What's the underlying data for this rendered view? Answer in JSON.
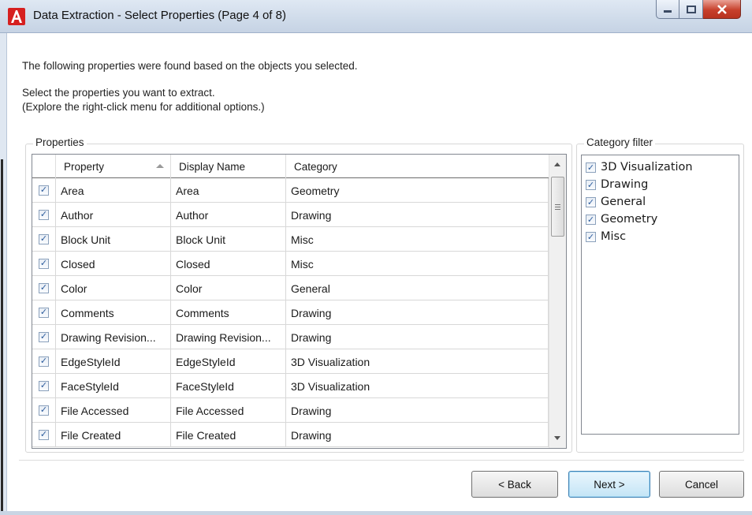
{
  "window": {
    "title": "Data Extraction - Select Properties (Page 4 of 8)",
    "app_icon": "autocad-logo-icon",
    "controls": [
      "minimize-icon",
      "maximize-icon",
      "close-icon"
    ]
  },
  "intro": {
    "line1": "The following properties were found based on the objects you selected.",
    "line2": "Select the properties you want to extract.",
    "line3": "(Explore the right-click menu for additional options.)"
  },
  "properties": {
    "group_label": "Properties",
    "columns": [
      "",
      "Property",
      "Display Name",
      "Category"
    ],
    "sort_column": "Property",
    "sort_direction": "ascending",
    "rows": [
      {
        "checked": true,
        "property": "Area",
        "display_name": "Area",
        "category": "Geometry"
      },
      {
        "checked": true,
        "property": "Author",
        "display_name": "Author",
        "category": "Drawing"
      },
      {
        "checked": true,
        "property": "Block Unit",
        "display_name": "Block Unit",
        "category": "Misc"
      },
      {
        "checked": true,
        "property": "Closed",
        "display_name": "Closed",
        "category": "Misc"
      },
      {
        "checked": true,
        "property": "Color",
        "display_name": "Color",
        "category": "General"
      },
      {
        "checked": true,
        "property": "Comments",
        "display_name": "Comments",
        "category": "Drawing"
      },
      {
        "checked": true,
        "property": "Drawing Revision...",
        "display_name": "Drawing Revision...",
        "category": "Drawing"
      },
      {
        "checked": true,
        "property": "EdgeStyleId",
        "display_name": "EdgeStyleId",
        "category": "3D Visualization"
      },
      {
        "checked": true,
        "property": "FaceStyleId",
        "display_name": "FaceStyleId",
        "category": "3D Visualization"
      },
      {
        "checked": true,
        "property": "File Accessed",
        "display_name": "File Accessed",
        "category": "Drawing"
      },
      {
        "checked": true,
        "property": "File Created",
        "display_name": "File Created",
        "category": "Drawing"
      }
    ]
  },
  "category_filter": {
    "group_label": "Category filter",
    "items": [
      {
        "label": "3D Visualization",
        "checked": true
      },
      {
        "label": "Drawing",
        "checked": true
      },
      {
        "label": "General",
        "checked": true
      },
      {
        "label": "Geometry",
        "checked": true
      },
      {
        "label": "Misc",
        "checked": true
      }
    ]
  },
  "buttons": {
    "back": "< Back",
    "next": "Next >",
    "cancel": "Cancel"
  },
  "colors": {
    "accent": "#3c7fb1",
    "close_button": "#c7402c",
    "app_icon": "#d62020"
  }
}
